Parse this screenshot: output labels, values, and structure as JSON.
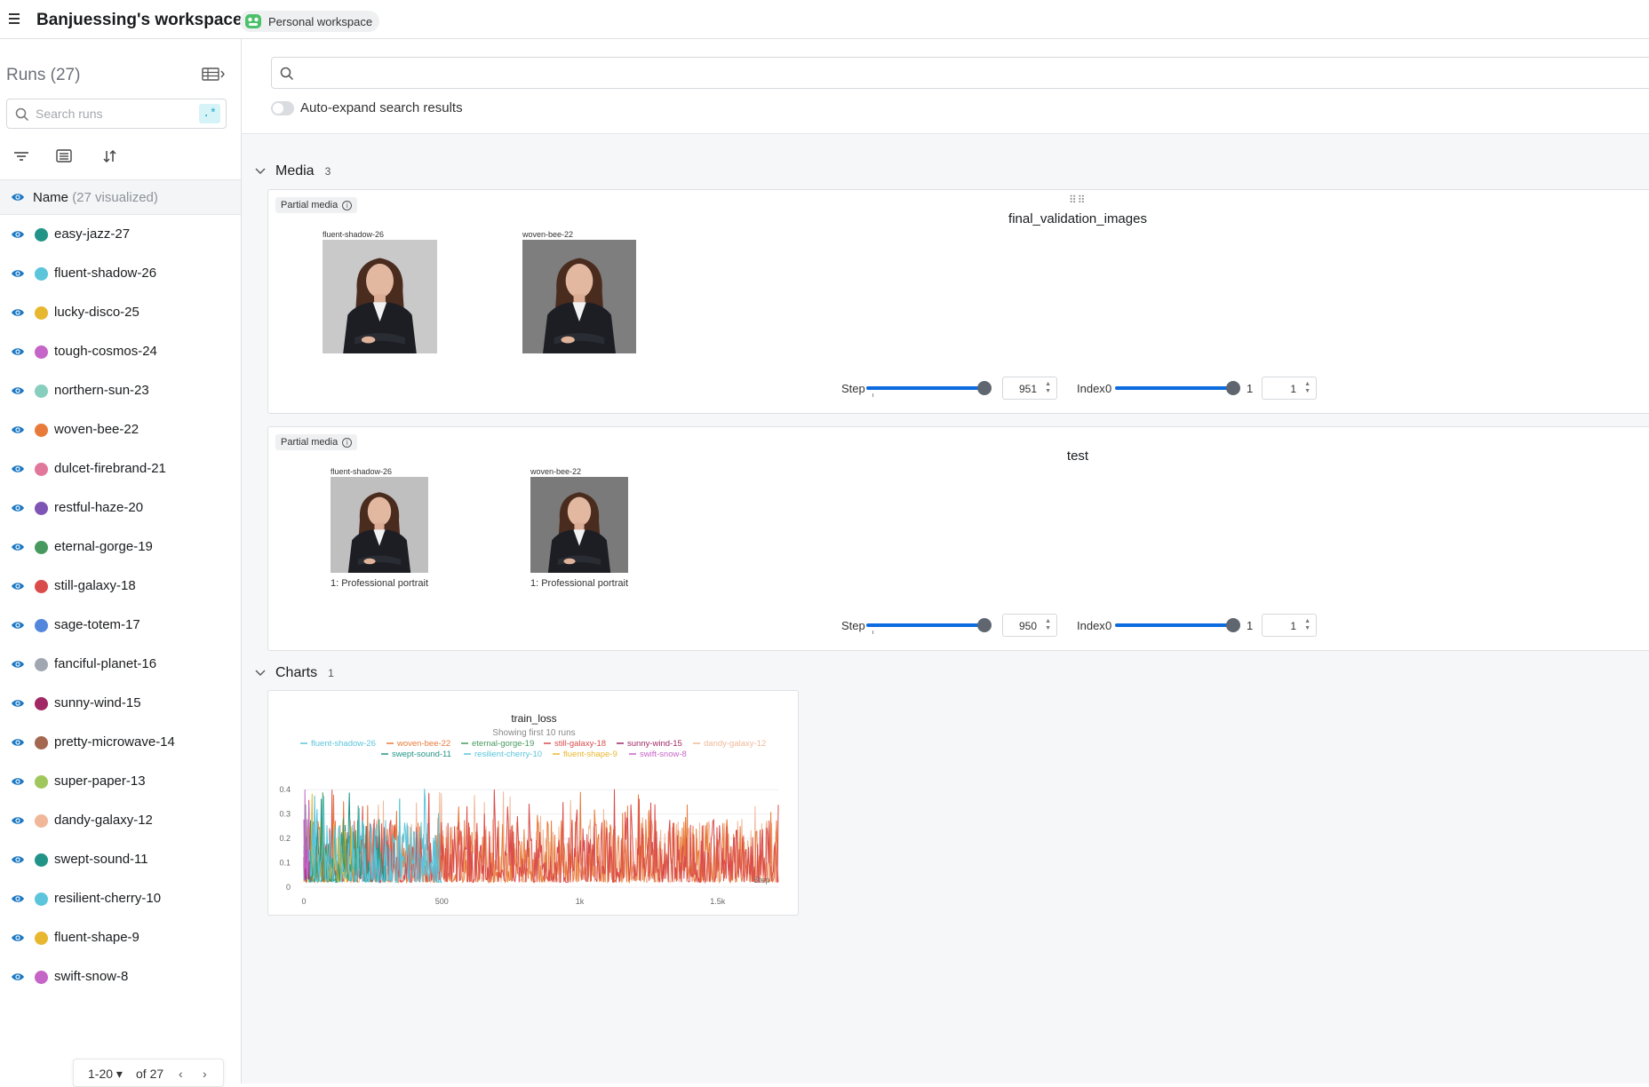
{
  "header": {
    "workspace_title": "Banjuessing's workspace",
    "workspace_badge": "Personal workspace"
  },
  "sidebar": {
    "runs_title": "Runs (27)",
    "search_placeholder": "Search runs",
    "regex_label": ".*",
    "name_header": "Name",
    "name_header_sub": "(27 visualized)",
    "runs": [
      {
        "name": "easy-jazz-27",
        "color": "#229487"
      },
      {
        "name": "fluent-shadow-26",
        "color": "#5bc5db"
      },
      {
        "name": "lucky-disco-25",
        "color": "#e8b730"
      },
      {
        "name": "tough-cosmos-24",
        "color": "#c565c7"
      },
      {
        "name": "northern-sun-23",
        "color": "#87cebf"
      },
      {
        "name": "woven-bee-22",
        "color": "#e87b3a"
      },
      {
        "name": "dulcet-firebrand-21",
        "color": "#e1789c"
      },
      {
        "name": "restful-haze-20",
        "color": "#7e54b5"
      },
      {
        "name": "eternal-gorge-19",
        "color": "#479a5f"
      },
      {
        "name": "still-galaxy-18",
        "color": "#da4c4c"
      },
      {
        "name": "sage-totem-17",
        "color": "#5387dd"
      },
      {
        "name": "fanciful-planet-16",
        "color": "#a0a7b1"
      },
      {
        "name": "sunny-wind-15",
        "color": "#a12864"
      },
      {
        "name": "pretty-microwave-14",
        "color": "#a46750"
      },
      {
        "name": "super-paper-13",
        "color": "#a0c75c"
      },
      {
        "name": "dandy-galaxy-12",
        "color": "#f0b899"
      },
      {
        "name": "swept-sound-11",
        "color": "#229487"
      },
      {
        "name": "resilient-cherry-10",
        "color": "#5bc5db"
      },
      {
        "name": "fluent-shape-9",
        "color": "#e8b730"
      },
      {
        "name": "swift-snow-8",
        "color": "#c565c7"
      }
    ],
    "pager": {
      "range": "1-20",
      "of": "of 27"
    }
  },
  "main": {
    "auto_expand_label": "Auto-expand search results",
    "media_section": {
      "title": "Media",
      "count": "3"
    },
    "charts_section": {
      "title": "Charts",
      "count": "1"
    },
    "media_panels": [
      {
        "badge": "Partial media",
        "title": "final_validation_images",
        "thumbs": [
          {
            "label": "fluent-shadow-26",
            "caption": ""
          },
          {
            "label": "woven-bee-22",
            "caption": ""
          }
        ],
        "step_label": "Step",
        "step_value": "951",
        "index_label": "Index",
        "index_min": "0",
        "index_max": "1",
        "index_value": "1"
      },
      {
        "badge": "Partial media",
        "title": "test",
        "thumbs": [
          {
            "label": "fluent-shadow-26",
            "caption": "1: Professional portrait"
          },
          {
            "label": "woven-bee-22",
            "caption": "1: Professional portrait"
          }
        ],
        "step_label": "Step",
        "step_value": "950",
        "index_label": "Index",
        "index_min": "0",
        "index_max": "1",
        "index_value": "1"
      }
    ]
  },
  "chart_data": {
    "type": "line",
    "title": "train_loss",
    "subtitle": "Showing first 10 runs",
    "xlabel": "Step",
    "ylabel": "",
    "xlim": [
      0,
      1720
    ],
    "ylim": [
      0,
      0.43
    ],
    "x_ticks": [
      "0",
      "500",
      "1k",
      "1.5k"
    ],
    "y_ticks": [
      "0",
      "0.1",
      "0.2",
      "0.3",
      "0.4"
    ],
    "legend_placement": "top",
    "series": [
      {
        "name": "fluent-shadow-26",
        "color": "#5bc5db",
        "x_range": [
          0,
          500
        ]
      },
      {
        "name": "woven-bee-22",
        "color": "#e87b3a",
        "x_range": [
          0,
          1720
        ]
      },
      {
        "name": "eternal-gorge-19",
        "color": "#479a5f",
        "x_range": [
          0,
          200
        ]
      },
      {
        "name": "still-galaxy-18",
        "color": "#da4c4c",
        "x_range": [
          0,
          1720
        ]
      },
      {
        "name": "sunny-wind-15",
        "color": "#a12864",
        "x_range": [
          0,
          20
        ]
      },
      {
        "name": "dandy-galaxy-12",
        "color": "#f0b899",
        "x_range": [
          0,
          1720
        ]
      },
      {
        "name": "swept-sound-11",
        "color": "#229487",
        "x_range": [
          0,
          300
        ]
      },
      {
        "name": "resilient-cherry-10",
        "color": "#5bc5db",
        "x_range": [
          0,
          500
        ]
      },
      {
        "name": "fluent-shape-9",
        "color": "#e8b730",
        "x_range": [
          0,
          180
        ]
      },
      {
        "name": "swift-snow-8",
        "color": "#c565c7",
        "x_range": [
          0,
          20
        ]
      }
    ]
  }
}
